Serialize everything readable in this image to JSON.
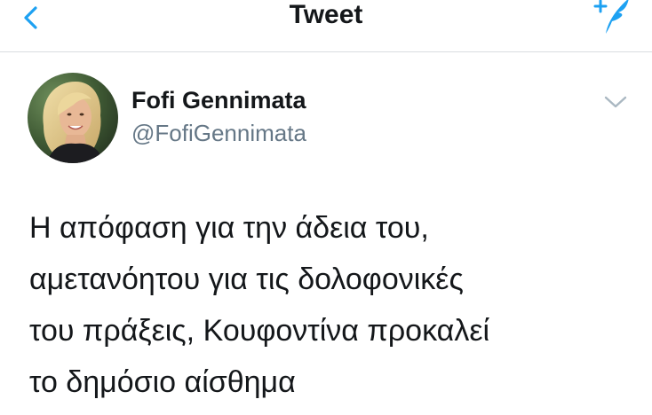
{
  "header": {
    "title": "Tweet",
    "back_icon": "chevron-left-icon",
    "compose_icon": "compose-tweet-icon",
    "accent_color": "#1da1f2"
  },
  "author": {
    "name": "Fofi Gennimata",
    "handle": "@FofiGennimata",
    "menu_icon": "chevron-down-icon"
  },
  "tweet": {
    "lines": [
      "Η απόφαση για την άδεια του,",
      "αμετανόητου για τις δολοφονικές",
      "του πράξεις, Κουφοντίνα προκαλεί",
      "το δημόσιο αίσθημα"
    ]
  }
}
